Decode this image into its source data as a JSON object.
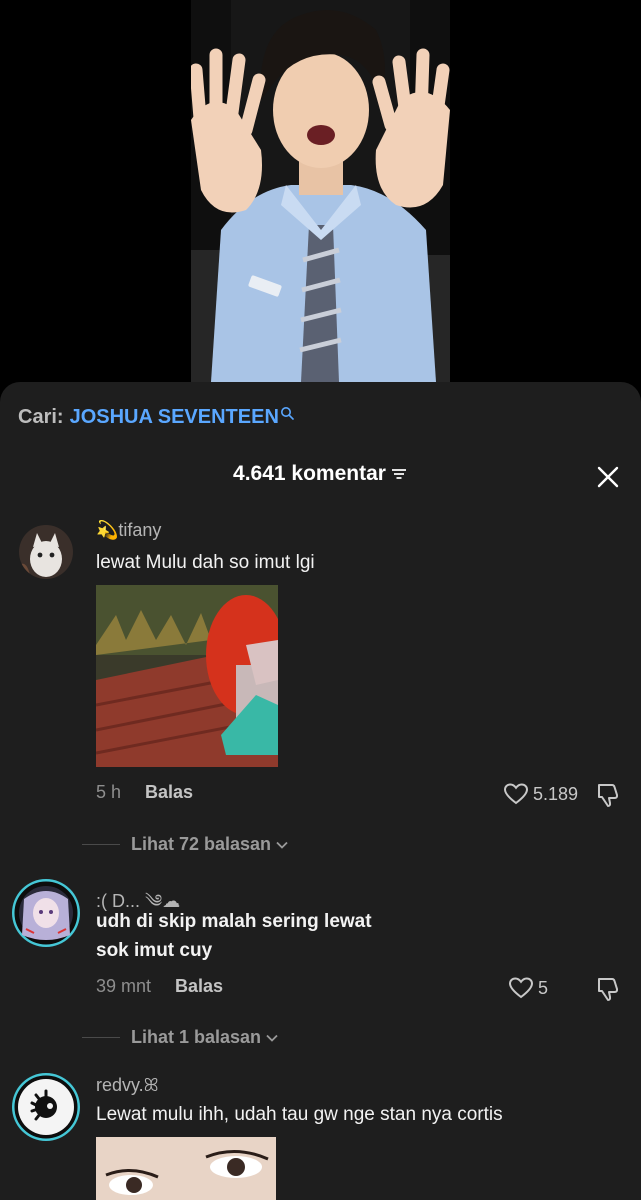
{
  "search": {
    "prefix": "Cari:",
    "term": "JOSHUA SEVENTEEN",
    "icon": "search-icon"
  },
  "header": {
    "count_label": "4.641 komentar",
    "filter_icon": "filter-icon",
    "close_icon": "close-icon"
  },
  "comments": [
    {
      "username": "💫tifany",
      "text": "lewat Mulu dah so imut lgi",
      "time": "5 h",
      "reply_label": "Balas",
      "likes": "5.189",
      "view_replies": "Lihat 72 balasan"
    },
    {
      "username": ":( D... ༄☁",
      "text_line1": "udh di skip malah sering lewat",
      "text_line2": "sok imut cuy",
      "time": "39 mnt",
      "reply_label": "Balas",
      "likes": "5",
      "view_replies": "Lihat 1 balasan"
    },
    {
      "username": "redvy.ꕤ",
      "text": "Lewat mulu ihh, udah tau gw nge stan nya cortis"
    }
  ],
  "colors": {
    "sheet_bg": "#1e1e1e",
    "search_accent": "#5aa7ff"
  }
}
